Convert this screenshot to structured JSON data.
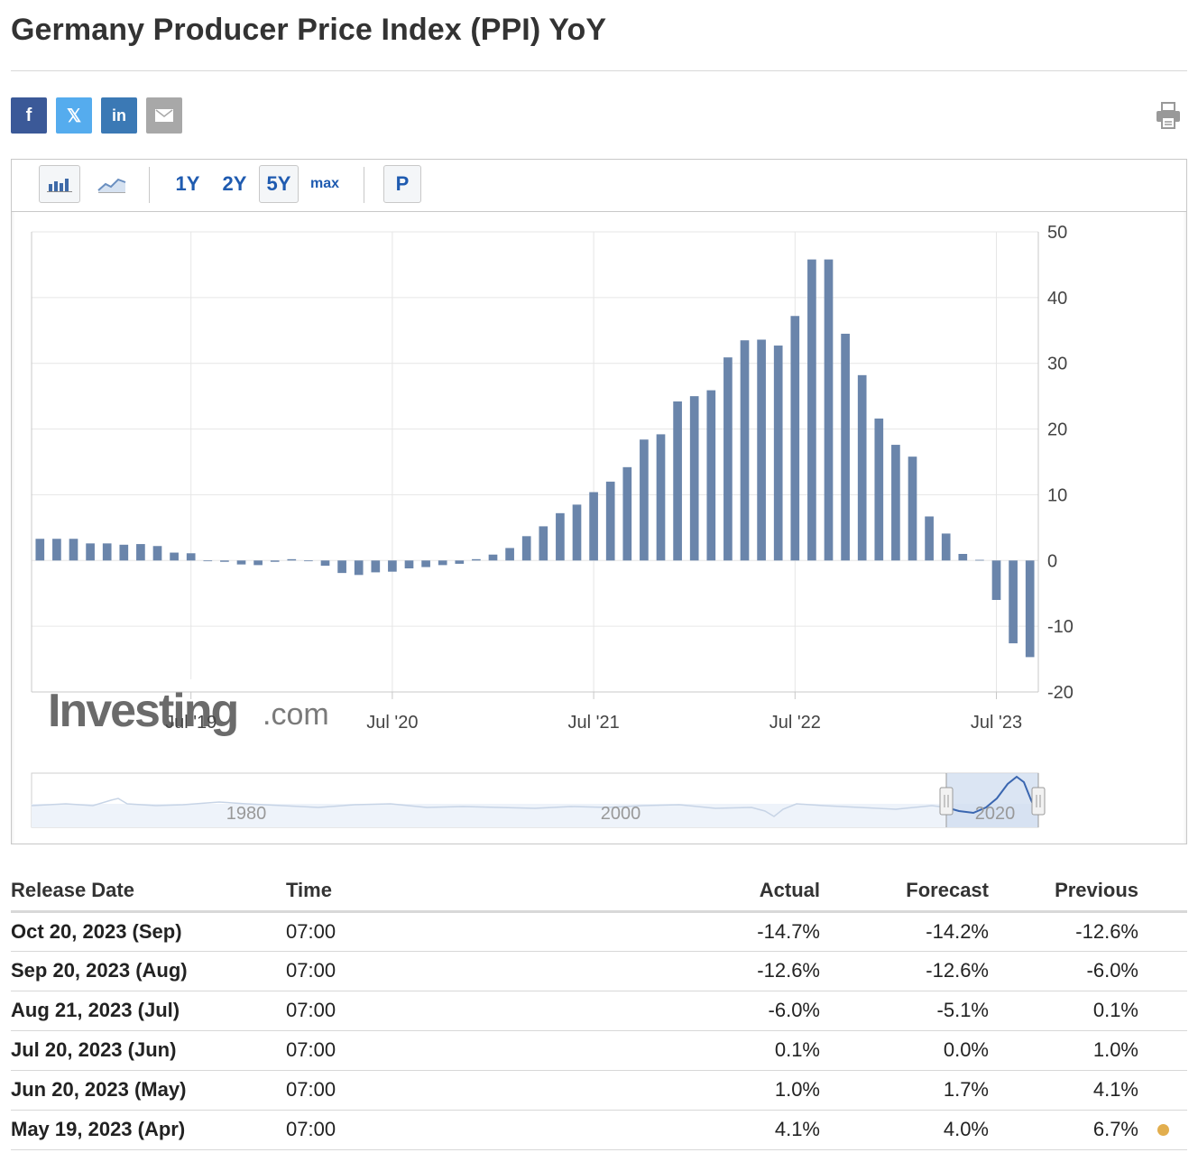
{
  "page": {
    "title": "Germany Producer Price Index (PPI) YoY"
  },
  "share": {
    "facebook": "f",
    "twitter": "𝕏",
    "linkedin": "in"
  },
  "toolbar": {
    "range_1y": "1Y",
    "range_2y": "2Y",
    "range_5y": "5Y",
    "range_max": "max",
    "pin": "P"
  },
  "watermark": {
    "brand": "Investing",
    "suffix": ".com"
  },
  "navigator": {
    "labels": [
      "1980",
      "2000",
      "2020"
    ]
  },
  "colors": {
    "bar": "#6a85ab",
    "negative": "#d93025",
    "positive": "#3e9d1e",
    "accent": "#1f5bb0"
  },
  "chart_data": {
    "type": "bar",
    "title": "",
    "xlabel": "",
    "ylabel": "",
    "ylim": [
      -20,
      50
    ],
    "y_ticks": [
      50,
      40,
      30,
      20,
      10,
      0,
      -10,
      -20
    ],
    "x_tick_labels": [
      "Jul '19",
      "Jul '20",
      "Jul '21",
      "Jul '22",
      "Jul '23"
    ],
    "grid": true,
    "x": [
      "Oct 2018",
      "Nov 2018",
      "Dec 2018",
      "Jan 2019",
      "Feb 2019",
      "Mar 2019",
      "Apr 2019",
      "May 2019",
      "Jun 2019",
      "Jul 2019",
      "Aug 2019",
      "Sep 2019",
      "Oct 2019",
      "Nov 2019",
      "Dec 2019",
      "Jan 2020",
      "Feb 2020",
      "Mar 2020",
      "Apr 2020",
      "May 2020",
      "Jun 2020",
      "Jul 2020",
      "Aug 2020",
      "Sep 2020",
      "Oct 2020",
      "Nov 2020",
      "Dec 2020",
      "Jan 2021",
      "Feb 2021",
      "Mar 2021",
      "Apr 2021",
      "May 2021",
      "Jun 2021",
      "Jul 2021",
      "Aug 2021",
      "Sep 2021",
      "Oct 2021",
      "Nov 2021",
      "Dec 2021",
      "Jan 2022",
      "Feb 2022",
      "Mar 2022",
      "Apr 2022",
      "May 2022",
      "Jun 2022",
      "Jul 2022",
      "Aug 2022",
      "Sep 2022",
      "Oct 2022",
      "Nov 2022",
      "Dec 2022",
      "Jan 2023",
      "Feb 2023",
      "Mar 2023",
      "Apr 2023",
      "May 2023",
      "Jun 2023",
      "Jul 2023",
      "Aug 2023",
      "Sep 2023"
    ],
    "series": [
      {
        "values": [
          3.3,
          3.3,
          3.3,
          2.6,
          2.6,
          2.4,
          2.5,
          2.2,
          1.2,
          1.1,
          -0.1,
          -0.2,
          -0.6,
          -0.7,
          -0.2,
          0.2,
          -0.1,
          -0.8,
          -1.9,
          -2.2,
          -1.8,
          -1.7,
          -1.2,
          -1.0,
          -0.7,
          -0.5,
          0.2,
          0.9,
          1.9,
          3.7,
          5.2,
          7.2,
          8.5,
          10.4,
          12.0,
          14.2,
          18.4,
          19.2,
          24.2,
          25.0,
          25.9,
          30.9,
          33.5,
          33.6,
          32.7,
          37.2,
          45.8,
          45.8,
          34.5,
          28.2,
          21.6,
          17.6,
          15.8,
          6.7,
          4.1,
          1.0,
          0.1,
          -6.0,
          -12.6,
          -14.7
        ]
      }
    ]
  },
  "table": {
    "headers": {
      "date": "Release Date",
      "time": "Time",
      "actual": "Actual",
      "forecast": "Forecast",
      "previous": "Previous"
    },
    "rows": [
      {
        "date": "Oct 20, 2023 (Sep)",
        "time": "07:00",
        "actual": "-14.7%",
        "actual_status": "neg",
        "forecast": "-14.2%",
        "previous": "-12.6%",
        "previous_status": "neu",
        "revised": false
      },
      {
        "date": "Sep 20, 2023 (Aug)",
        "time": "07:00",
        "actual": "-12.6%",
        "actual_status": "neu",
        "forecast": "-12.6%",
        "previous": "-6.0%",
        "previous_status": "neu",
        "revised": false
      },
      {
        "date": "Aug 21, 2023 (Jul)",
        "time": "07:00",
        "actual": "-6.0%",
        "actual_status": "neg",
        "forecast": "-5.1%",
        "previous": "0.1%",
        "previous_status": "neu",
        "revised": false
      },
      {
        "date": "Jul 20, 2023 (Jun)",
        "time": "07:00",
        "actual": "0.1%",
        "actual_status": "pos",
        "forecast": "0.0%",
        "previous": "1.0%",
        "previous_status": "neu",
        "revised": false
      },
      {
        "date": "Jun 20, 2023 (May)",
        "time": "07:00",
        "actual": "1.0%",
        "actual_status": "neg",
        "forecast": "1.7%",
        "previous": "4.1%",
        "previous_status": "neu",
        "revised": false
      },
      {
        "date": "May 19, 2023 (Apr)",
        "time": "07:00",
        "actual": "4.1%",
        "actual_status": "pos",
        "forecast": "4.0%",
        "previous": "6.7%",
        "previous_status": "neg",
        "revised": true
      }
    ]
  }
}
